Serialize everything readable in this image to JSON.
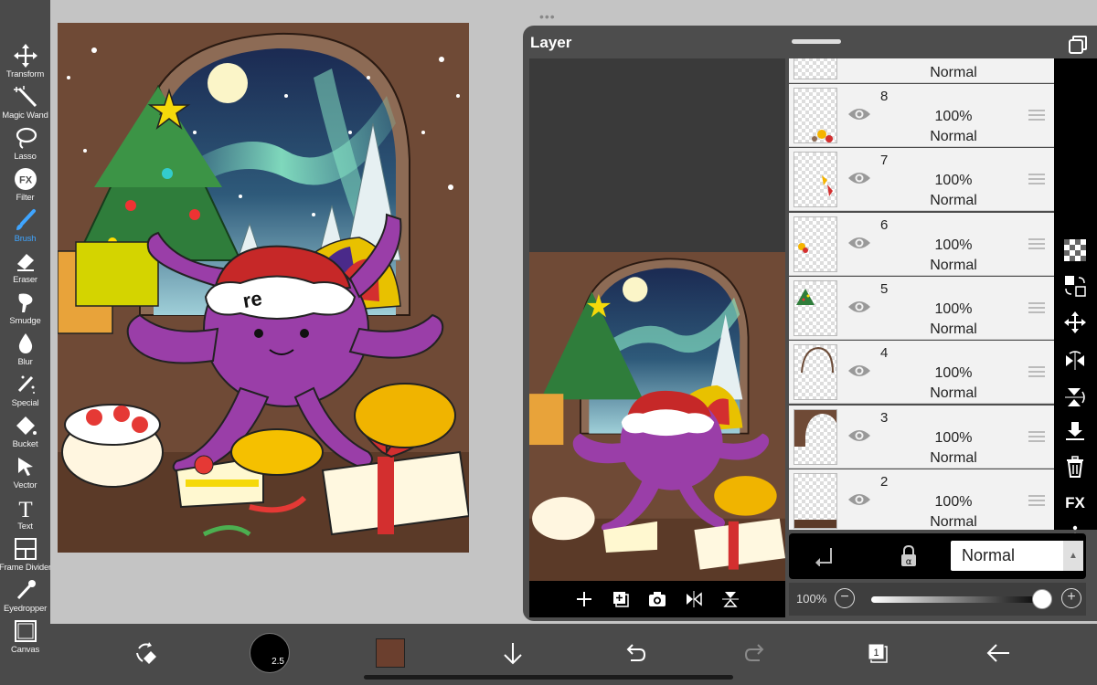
{
  "toolbar": {
    "tools": [
      {
        "label": "Transform",
        "icon": "move-arrows-icon"
      },
      {
        "label": "Magic Wand",
        "icon": "magic-wand-icon"
      },
      {
        "label": "Lasso",
        "icon": "lasso-icon"
      },
      {
        "label": "Filter",
        "icon": "fx-filter-icon"
      },
      {
        "label": "Brush",
        "icon": "brush-icon",
        "active": true
      },
      {
        "label": "Eraser",
        "icon": "eraser-icon"
      },
      {
        "label": "Smudge",
        "icon": "smudge-icon"
      },
      {
        "label": "Blur",
        "icon": "droplet-icon"
      },
      {
        "label": "Special",
        "icon": "special-pen-icon"
      },
      {
        "label": "Bucket",
        "icon": "bucket-icon"
      },
      {
        "label": "Vector",
        "icon": "vector-cursor-icon"
      },
      {
        "label": "Text",
        "icon": "text-icon"
      },
      {
        "label": "Frame Divider",
        "icon": "frame-divider-icon"
      },
      {
        "label": "Eyedropper",
        "icon": "eyedropper-icon"
      },
      {
        "label": "Canvas",
        "icon": "canvas-icon"
      }
    ],
    "active_color": "#3fa5ff"
  },
  "bottom_bar": {
    "brush_size": "2.5",
    "current_color": "#6b3f2e",
    "layers_count": "1"
  },
  "layer_panel": {
    "title": "Layer",
    "top_partial_mode": "Normal",
    "layers": [
      {
        "name": "8",
        "opacity": "100%",
        "mode": "Normal"
      },
      {
        "name": "7",
        "opacity": "100%",
        "mode": "Normal"
      },
      {
        "name": "6",
        "opacity": "100%",
        "mode": "Normal"
      },
      {
        "name": "5",
        "opacity": "100%",
        "mode": "Normal"
      },
      {
        "name": "4",
        "opacity": "100%",
        "mode": "Normal"
      },
      {
        "name": "3",
        "opacity": "100%",
        "mode": "Normal"
      },
      {
        "name": "2",
        "opacity": "100%",
        "mode": "Normal"
      }
    ],
    "side_tools": [
      "checker-icon",
      "move-to-layer-icon",
      "move-icon",
      "flip-horizontal-icon",
      "flip-vertical-icon",
      "merge-down-icon",
      "trash-icon",
      "FX",
      "more-icon"
    ],
    "fx_label": "FX",
    "blend_mode": "Normal",
    "opacity_label": "100%",
    "opacity_value": 1.0
  },
  "artwork": {
    "hat_text": "re"
  }
}
